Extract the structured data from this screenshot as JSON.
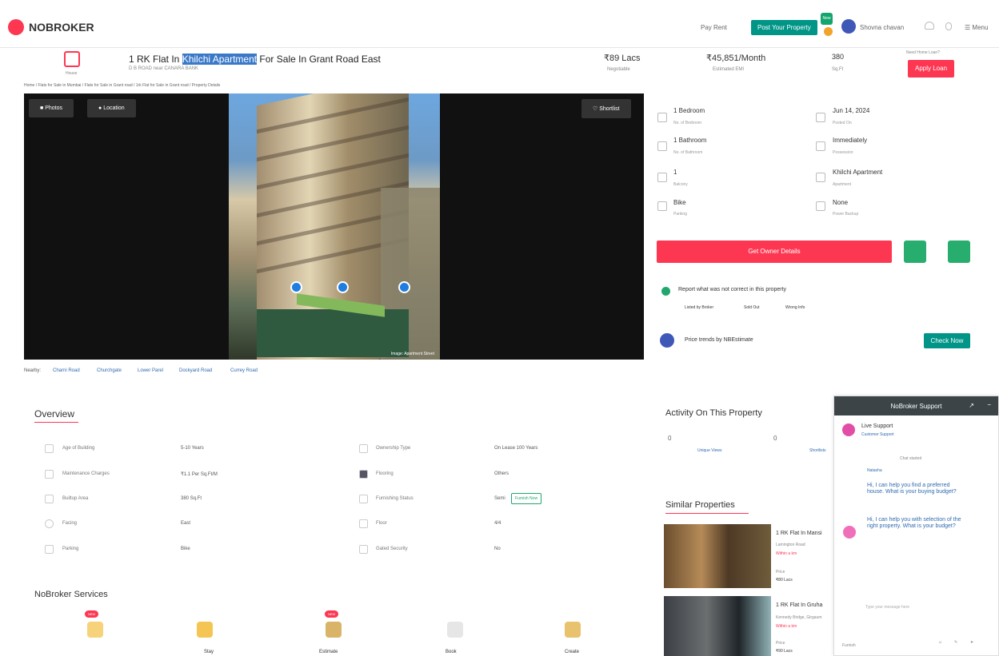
{
  "header": {
    "brand": "NOBROKER",
    "nav_link": "Pay Rent",
    "post_button": "Post Your Property",
    "badge": "New",
    "user_name": "Shovna chavan",
    "menu_label": "Menu"
  },
  "property": {
    "icon_label": "House",
    "title_prefix": "1 RK Flat In ",
    "title_highlight": "Khilchi Apartment",
    "title_suffix": " For Sale In Grant Road East",
    "address": "D B ROAD near CANARA BANK",
    "price": "₹89 Lacs",
    "price_note": "Negotiable",
    "emi": "₹45,851/Month",
    "emi_note": "Estimated EMI",
    "area": "380",
    "area_unit": "Sq.Ft",
    "loan_question": "Need Home Loan?",
    "loan_button": "Apply Loan",
    "breadcrumb": "Home / Flats for Sale in Mumbai / Flats for Sale in Grant road / 1rk Flat for Sale in Grant road / Property Details"
  },
  "gallery": {
    "photos_btn": "Photos",
    "location_btn": "Location",
    "shortlist_btn": "Shortlist",
    "credit": "Image: Apartment Street"
  },
  "nearby": {
    "label": "Nearby:",
    "items": [
      "Charni Road",
      "Churchgate",
      "Lower Parel",
      "Dockyard Road",
      "Currey Road"
    ]
  },
  "details": [
    {
      "label": "1 Bedroom",
      "sub": "No. of Bedroom"
    },
    {
      "label": "1 Bathroom",
      "sub": "No. of Bathroom"
    },
    {
      "label": "1",
      "sub": "Balcony"
    },
    {
      "label": "Bike",
      "sub": "Parking"
    },
    {
      "label": "Jun 14, 2024",
      "sub": "Posted On"
    },
    {
      "label": "Immediately",
      "sub": "Possession"
    },
    {
      "label": "Khilchi Apartment",
      "sub": "Apartment"
    },
    {
      "label": "None",
      "sub": "Power Backup"
    }
  ],
  "actions": {
    "owner_button": "Get Owner Details",
    "report_text": "Report what was not correct in this property",
    "report_links": [
      "Listed by Broker",
      "Sold Out",
      "Wrong Info"
    ],
    "trend_text": "Price trends by NBEstimate",
    "check_button": "Check Now"
  },
  "overview": {
    "title": "Overview",
    "rows": [
      {
        "label": "Age of Building",
        "value": "5-10 Years",
        "label2": "Ownership Type",
        "value2": "On Lease 100 Years"
      },
      {
        "label": "Maintenance Charges",
        "value": "₹1.1 Per Sq.Ft/M",
        "label2": "Flooring",
        "value2": "Others"
      },
      {
        "label": "Builtup Area",
        "value": "380 Sq.Ft",
        "label2": "Furnishing Status",
        "value2": "Semi"
      },
      {
        "label": "Facing",
        "value": "East",
        "label2": "Floor",
        "value2": "4/4"
      },
      {
        "label": "Parking",
        "value": "Bike",
        "label2": "Gated Security",
        "value2": "No"
      }
    ],
    "furnish_button": "Furnish Now"
  },
  "services": {
    "title": "NoBroker Services",
    "new_badge": "NEW",
    "items": [
      "Stay",
      "Estimate",
      "Book",
      "Create"
    ]
  },
  "activity": {
    "title": "Activity On This Property",
    "views_count": "0",
    "views_label": "Unique Views",
    "shortlist_count": "0",
    "shortlist_label": "Shortlists"
  },
  "similar": {
    "title": "Similar Properties",
    "items": [
      {
        "title": "1 RK Flat In Mansi",
        "location": "Lamington Road",
        "distance": "Within a km",
        "price_label": "Price",
        "price": "₹80 Lacs"
      },
      {
        "title": "1 RK Flat In Gruha",
        "location": "Kennedy Bridge, Girgaum",
        "distance": "Within a km",
        "price_label": "Price",
        "price": "₹90 Lacs"
      }
    ]
  },
  "chat": {
    "title": "NoBroker Support",
    "support_name": "Live Support",
    "support_role": "Customer Support",
    "started": "Chat started",
    "agent": "Natasha",
    "msg1": "Hi, I can help you find a preferred house. What is your buying budget?",
    "msg2": "Hi, I can help you with selection of the right property. What is your budget?",
    "input_placeholder": "Type your message here",
    "furnish_label": "Furnish"
  }
}
